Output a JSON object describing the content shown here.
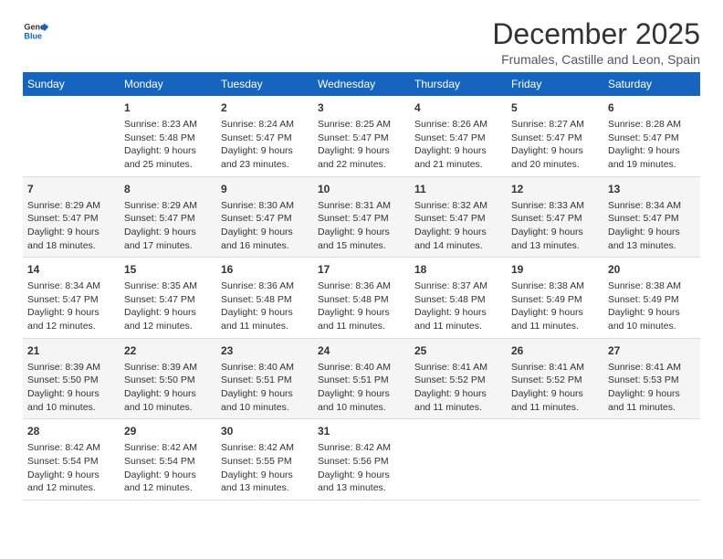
{
  "logo": {
    "line1": "General",
    "line2": "Blue"
  },
  "title": "December 2025",
  "subtitle": "Frumales, Castille and Leon, Spain",
  "weekdays": [
    "Sunday",
    "Monday",
    "Tuesday",
    "Wednesday",
    "Thursday",
    "Friday",
    "Saturday"
  ],
  "weeks": [
    [
      {
        "day": "",
        "info": ""
      },
      {
        "day": "1",
        "info": "Sunrise: 8:23 AM\nSunset: 5:48 PM\nDaylight: 9 hours\nand 25 minutes."
      },
      {
        "day": "2",
        "info": "Sunrise: 8:24 AM\nSunset: 5:47 PM\nDaylight: 9 hours\nand 23 minutes."
      },
      {
        "day": "3",
        "info": "Sunrise: 8:25 AM\nSunset: 5:47 PM\nDaylight: 9 hours\nand 22 minutes."
      },
      {
        "day": "4",
        "info": "Sunrise: 8:26 AM\nSunset: 5:47 PM\nDaylight: 9 hours\nand 21 minutes."
      },
      {
        "day": "5",
        "info": "Sunrise: 8:27 AM\nSunset: 5:47 PM\nDaylight: 9 hours\nand 20 minutes."
      },
      {
        "day": "6",
        "info": "Sunrise: 8:28 AM\nSunset: 5:47 PM\nDaylight: 9 hours\nand 19 minutes."
      }
    ],
    [
      {
        "day": "7",
        "info": "Sunrise: 8:29 AM\nSunset: 5:47 PM\nDaylight: 9 hours\nand 18 minutes."
      },
      {
        "day": "8",
        "info": "Sunrise: 8:29 AM\nSunset: 5:47 PM\nDaylight: 9 hours\nand 17 minutes."
      },
      {
        "day": "9",
        "info": "Sunrise: 8:30 AM\nSunset: 5:47 PM\nDaylight: 9 hours\nand 16 minutes."
      },
      {
        "day": "10",
        "info": "Sunrise: 8:31 AM\nSunset: 5:47 PM\nDaylight: 9 hours\nand 15 minutes."
      },
      {
        "day": "11",
        "info": "Sunrise: 8:32 AM\nSunset: 5:47 PM\nDaylight: 9 hours\nand 14 minutes."
      },
      {
        "day": "12",
        "info": "Sunrise: 8:33 AM\nSunset: 5:47 PM\nDaylight: 9 hours\nand 13 minutes."
      },
      {
        "day": "13",
        "info": "Sunrise: 8:34 AM\nSunset: 5:47 PM\nDaylight: 9 hours\nand 13 minutes."
      }
    ],
    [
      {
        "day": "14",
        "info": "Sunrise: 8:34 AM\nSunset: 5:47 PM\nDaylight: 9 hours\nand 12 minutes."
      },
      {
        "day": "15",
        "info": "Sunrise: 8:35 AM\nSunset: 5:47 PM\nDaylight: 9 hours\nand 12 minutes."
      },
      {
        "day": "16",
        "info": "Sunrise: 8:36 AM\nSunset: 5:48 PM\nDaylight: 9 hours\nand 11 minutes."
      },
      {
        "day": "17",
        "info": "Sunrise: 8:36 AM\nSunset: 5:48 PM\nDaylight: 9 hours\nand 11 minutes."
      },
      {
        "day": "18",
        "info": "Sunrise: 8:37 AM\nSunset: 5:48 PM\nDaylight: 9 hours\nand 11 minutes."
      },
      {
        "day": "19",
        "info": "Sunrise: 8:38 AM\nSunset: 5:49 PM\nDaylight: 9 hours\nand 11 minutes."
      },
      {
        "day": "20",
        "info": "Sunrise: 8:38 AM\nSunset: 5:49 PM\nDaylight: 9 hours\nand 10 minutes."
      }
    ],
    [
      {
        "day": "21",
        "info": "Sunrise: 8:39 AM\nSunset: 5:50 PM\nDaylight: 9 hours\nand 10 minutes."
      },
      {
        "day": "22",
        "info": "Sunrise: 8:39 AM\nSunset: 5:50 PM\nDaylight: 9 hours\nand 10 minutes."
      },
      {
        "day": "23",
        "info": "Sunrise: 8:40 AM\nSunset: 5:51 PM\nDaylight: 9 hours\nand 10 minutes."
      },
      {
        "day": "24",
        "info": "Sunrise: 8:40 AM\nSunset: 5:51 PM\nDaylight: 9 hours\nand 10 minutes."
      },
      {
        "day": "25",
        "info": "Sunrise: 8:41 AM\nSunset: 5:52 PM\nDaylight: 9 hours\nand 11 minutes."
      },
      {
        "day": "26",
        "info": "Sunrise: 8:41 AM\nSunset: 5:52 PM\nDaylight: 9 hours\nand 11 minutes."
      },
      {
        "day": "27",
        "info": "Sunrise: 8:41 AM\nSunset: 5:53 PM\nDaylight: 9 hours\nand 11 minutes."
      }
    ],
    [
      {
        "day": "28",
        "info": "Sunrise: 8:42 AM\nSunset: 5:54 PM\nDaylight: 9 hours\nand 12 minutes."
      },
      {
        "day": "29",
        "info": "Sunrise: 8:42 AM\nSunset: 5:54 PM\nDaylight: 9 hours\nand 12 minutes."
      },
      {
        "day": "30",
        "info": "Sunrise: 8:42 AM\nSunset: 5:55 PM\nDaylight: 9 hours\nand 13 minutes."
      },
      {
        "day": "31",
        "info": "Sunrise: 8:42 AM\nSunset: 5:56 PM\nDaylight: 9 hours\nand 13 minutes."
      },
      {
        "day": "",
        "info": ""
      },
      {
        "day": "",
        "info": ""
      },
      {
        "day": "",
        "info": ""
      }
    ]
  ]
}
